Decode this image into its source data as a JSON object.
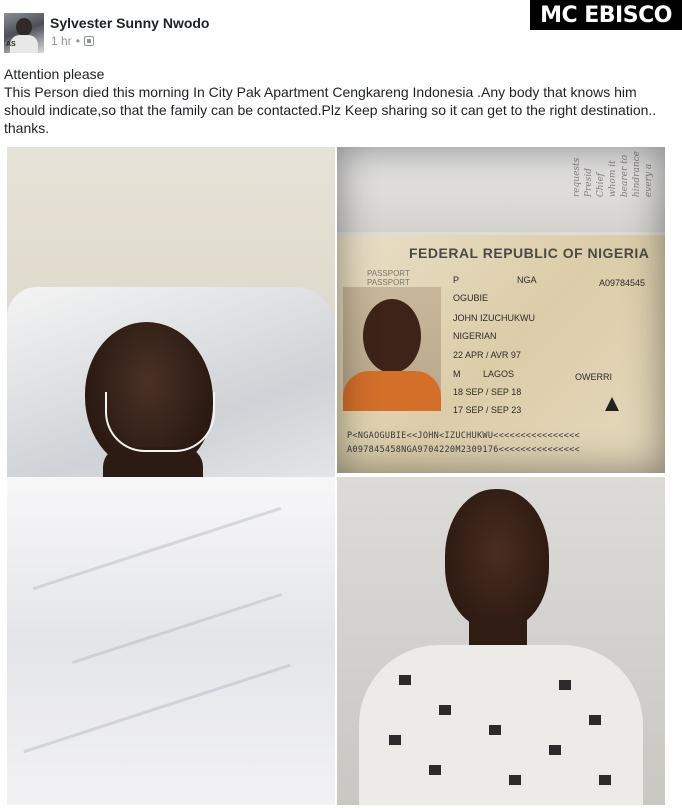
{
  "post": {
    "author_name": "Sylvester Sunny Nwodo",
    "timestamp": "1 hr",
    "separator": "•",
    "privacy_icon": "globe-icon",
    "watermark_text": "MC EBISCO",
    "body_lines": [
      "Attention please",
      "This Person died this morning In  City Pak Apartment  Cengkareng Indonesia .Any body that knows him should indicate,so that the family can be contacted.Plz Keep sharing so it can get to the right destination.. thanks."
    ]
  },
  "passport": {
    "country": "FEDERAL REPUBLIC OF NIGERIA",
    "doc_label": "PASSPORT",
    "type": "P",
    "code": "NGA",
    "number": "A09784545",
    "surname": "OGUBIE",
    "given_names": "JOHN IZUCHUKWU",
    "nationality": "NIGERIAN",
    "dob": "22 APR / AVR 97",
    "sex": "M",
    "place_of_birth": "LAGOS",
    "authority": "OWERRI",
    "issue_date": "18 SEP / SEP 18",
    "expiry_date": "17 SEP / SEP 23",
    "mrz_line1": "P<NGAOGUBIE<<JOHN<IZUCHUKWU<<<<<<<<<<<<<<<<",
    "mrz_line2": "A097845458NGA9704220M2309176<<<<<<<<<<<<<<<"
  }
}
